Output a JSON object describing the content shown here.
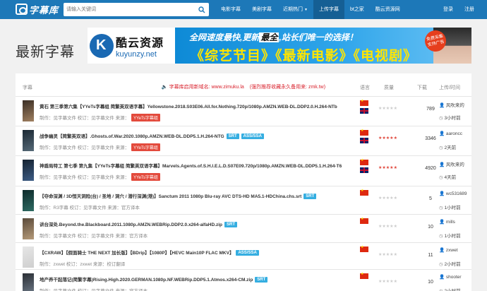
{
  "header": {
    "logo_text": "字幕库",
    "search_placeholder": "请输入关键词",
    "nav": [
      {
        "label": "电影字幕",
        "active": false
      },
      {
        "label": "美剧字幕",
        "active": false
      },
      {
        "label": "近期热门",
        "active": false
      },
      {
        "label": "上传字幕",
        "active": true
      },
      {
        "label": "bt之家",
        "active": false
      },
      {
        "label": "酷云资源网",
        "active": false
      }
    ],
    "login": "登录",
    "register": "注册"
  },
  "page": {
    "title": "最新字幕",
    "banner": {
      "brand_cn": "酷云资源",
      "brand_en": "kuyunzy.net",
      "line1_pre": "全网速度最快,更新",
      "line1_em": "最全",
      "line1_post": ",站长们唯一的选择！",
      "line2": "《综艺节目》《最新电影》《电视剧》",
      "badge": "免费采集 支持广告"
    },
    "notice": "字幕库启用新域名: www.zimuku.la",
    "notice2": "(强烈推荐收藏永久备用来: zmk.tw)"
  },
  "table": {
    "headers": [
      "字幕",
      "语言",
      "质量",
      "下载",
      "上传/时间"
    ],
    "rows": [
      {
        "title": "黄石 第三季第六集【YYeTs字幕组 简繁英双语字幕】Yellowstone.2018.S03E06.All.for.Nothing.720p/1080p.AMZN.WEB-DL.DDP2.0.H.264-NTb",
        "tags": [],
        "meta": "制作：见字幕文件  校订：见字幕文件  来源：",
        "meta_tag": "YYeTs字幕组",
        "flags": [
          "cn",
          "uk"
        ],
        "rating": 0,
        "downloads": "789",
        "uploader": "风吹来的",
        "time": "3小时前",
        "thumb": [
          "#3a2e25",
          "#a08060"
        ]
      },
      {
        "title": "战争幽灵【简繁英双语】.Ghosts.of.War.2020.1080p.AMZN.WEB-DL.DDP5.1.H.264-NTG",
        "tags": [
          "SRT",
          "ASS/SSA"
        ],
        "meta": "制作：见字幕文件  校订：见字幕文件  来源：",
        "meta_tag": "YYeTs字幕组",
        "flags": [
          "cn",
          "uk"
        ],
        "rating": 5,
        "downloads": "3346",
        "uploader": "aaroncc",
        "time": "2天前",
        "thumb": [
          "#1b2833",
          "#566a78"
        ]
      },
      {
        "title": "神盾局特工 第七季 第九集【YYeTs字幕组 简繁英双语字幕】Marvels.Agents.of.S.H.I.E.L.D.S07E09.720p/1080p.AMZN.WEB-DL.DDP5.1.H.264-T6",
        "tags": [],
        "meta": "制作：见字幕文件  校订：见字幕文件  来源：",
        "meta_tag": "YYeTs字幕组",
        "flags": [
          "cn",
          "uk"
        ],
        "rating": 5,
        "downloads": "4920",
        "uploader": "风吹来的",
        "time": "4天前",
        "thumb": [
          "#14212f",
          "#3d5d86"
        ]
      },
      {
        "title": "【夺命深渊 / 3D恒天洞险(台) / 圣地 / 洞穴 / 潜行深渊(港)】Sanctum 2011 1080p Blu-ray AVC DTS-HD MA5.1-HDChina.chs.srt",
        "tags": [
          "SRT"
        ],
        "meta": "制作：R3字幕  校订：见字幕文件  来源：官方译本",
        "meta_tag": "",
        "flags": [
          "cn"
        ],
        "rating": 0,
        "downloads": "5",
        "uploader": "wc531689",
        "time": "1小时前",
        "thumb": [
          "#0d2a2a",
          "#2e6b63"
        ]
      },
      {
        "title": "讲台深处.Beyond.the.Blackboard.2011.1080p.AMZN.WEBRip.DDP2.0.x264-alfaHD.zip",
        "tags": [
          "SRT"
        ],
        "meta": "制作：见字幕文件  校订：见字幕文件  来源：官方译本",
        "meta_tag": "",
        "flags": [
          "cn"
        ],
        "rating": 0,
        "downloads": "10",
        "uploader": "mills",
        "time": "1小时前",
        "thumb": [
          "#5a4a3a",
          "#b59a79"
        ]
      },
      {
        "title": "【CXRAW】【假面骑士 THE NEXT 加长版】【BDrip】【1080P】【HEVC Main10P FLAC MKV】",
        "tags": [
          "ASS/SSA"
        ],
        "meta": "制作：zxwet  校订：zxwet  来源：校订翻译",
        "meta_tag": "",
        "flags": [
          "cn"
        ],
        "rating": 0,
        "downloads": "11",
        "uploader": "zxwet",
        "time": "2小时前",
        "thumb": [
          "#e6e6e6",
          "#cfcfcf"
        ]
      },
      {
        "title": "地产养干起落记(简繁字幕)Rising.High.2020.GERMAN.1080p.NF.WEBRip.DDP5.1.Atmos.x264-CM.zip",
        "tags": [
          "SRT"
        ],
        "meta": "制作：见字幕文件  校订：见字幕文件  来源：官方译本",
        "meta_tag": "",
        "flags": [
          "cn"
        ],
        "rating": 0,
        "downloads": "10",
        "uploader": "shooter",
        "time": "2小时前",
        "thumb": [
          "#2a2e34",
          "#6e7a88"
        ]
      }
    ]
  },
  "colors": {
    "nav_bg": "#1d78b8",
    "nav_active": "#155f94",
    "tag_srt": "#35aee1",
    "tag_yyets": "#e34a3c",
    "notice": "#d9232e",
    "star_on": "#e0463a"
  }
}
